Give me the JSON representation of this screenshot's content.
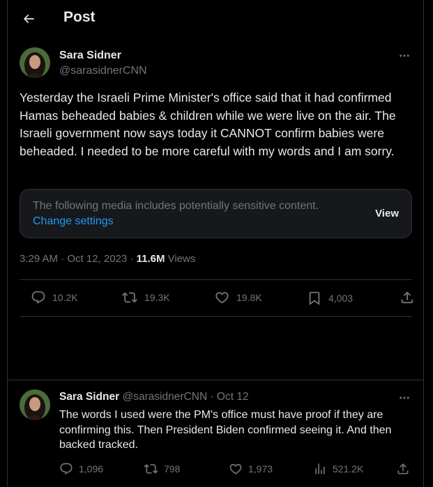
{
  "header": {
    "title": "Post"
  },
  "tweet": {
    "author_name": "Sara Sidner",
    "handle": "@sarasidnerCNN",
    "text": "Yesterday the Israeli Prime Minister's office said that it had confirmed Hamas beheaded babies & children while we were live on the air. The Israeli government now says today it CANNOT confirm  babies were beheaded.  I needed to be more careful with my words and I am sorry.",
    "sensitive_notice": "The following media includes potentially sensitive content.",
    "change_settings_label": "Change settings",
    "view_label": "View",
    "timestamp": "3:29 AM · Oct 12, 2023 · ",
    "views_count": "11.6M",
    "views_label": " Views",
    "actions": {
      "replies": "10.2K",
      "reposts": "19.3K",
      "likes": "19.8K",
      "bookmarks": "4,003"
    }
  },
  "reply": {
    "author_name": "Sara Sidner",
    "handle_date": "@sarasidnerCNN · Oct 12",
    "text": "The words I used were the PM's office must have proof if they are confirming this.  Then President Biden confirmed seeing it. And then backed tracked.",
    "actions": {
      "replies": "1,096",
      "reposts": "798",
      "likes": "1,973",
      "views": "521.2K"
    }
  },
  "icons": {
    "back": "arrow-left-icon",
    "more": "more-horizontal-icon",
    "reply": "comment-icon",
    "repost": "repost-icon",
    "like": "heart-icon",
    "bookmark": "bookmark-icon",
    "share": "share-icon",
    "views": "analytics-icon"
  },
  "colors": {
    "background": "#000000",
    "text": "#e7e9ea",
    "muted": "#71767b",
    "link": "#1d9bf0",
    "border": "#2f3336"
  }
}
